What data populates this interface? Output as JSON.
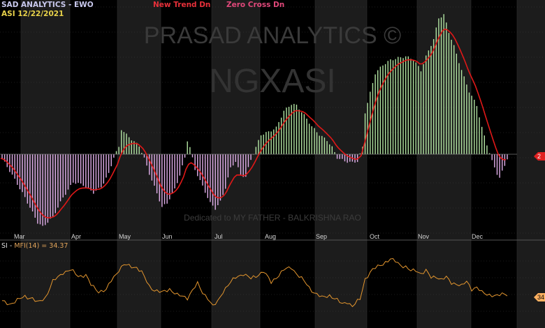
{
  "header": {
    "title": "SAD ANALYTICS - EWO",
    "symbol_date": "ASI   12/22/2021"
  },
  "legend": [
    "New Trend Dn",
    "Zero Cross Dn"
  ],
  "watermark": {
    "line1": "PRASAD ANALYTICS ©",
    "line2": "NGXASI",
    "dedication": "Dedicated to MY FATHER - BALKRISHNA RAO"
  },
  "lower_panel": {
    "label_prefix": "SI - ",
    "label_indicator": "MFI(14) = 34.37"
  },
  "colors": {
    "background": "#000000",
    "band_alt": "#1c1c1c",
    "grid": "#3a3a3a",
    "positive_bar": "#b4e6a4",
    "negative_bar": "#e3b0ec",
    "ewo_line": "#e01818",
    "mfi_line": "#e4962e",
    "tag_red": "#e02020",
    "tag_orange": "#ffb060"
  },
  "chart_data": [
    {
      "type": "bar",
      "name": "EWO histogram with red signal line",
      "months": [
        "Mar",
        "Apr",
        "May",
        "Jun",
        "Jul",
        "Aug",
        "Sep",
        "Oct",
        "Nov",
        "Dec"
      ],
      "bar_count": 200,
      "ewo_anchors": [
        [
          0,
          -6
        ],
        [
          4,
          -30
        ],
        [
          9,
          -62
        ],
        [
          14,
          -98
        ],
        [
          16,
          -104
        ],
        [
          20,
          -90
        ],
        [
          24,
          -62
        ],
        [
          28,
          -40
        ],
        [
          32,
          -44
        ],
        [
          36,
          -55
        ],
        [
          39,
          -47
        ],
        [
          42,
          -28
        ],
        [
          44,
          -4
        ],
        [
          46,
          10
        ],
        [
          47,
          36
        ],
        [
          49,
          28
        ],
        [
          52,
          18
        ],
        [
          54,
          12
        ],
        [
          56,
          -6
        ],
        [
          58,
          -28
        ],
        [
          61,
          -56
        ],
        [
          63,
          -76
        ],
        [
          65,
          -70
        ],
        [
          68,
          -50
        ],
        [
          70,
          -30
        ],
        [
          72,
          -5
        ],
        [
          73,
          20
        ],
        [
          74,
          10
        ],
        [
          76,
          -22
        ],
        [
          79,
          -46
        ],
        [
          82,
          -70
        ],
        [
          84,
          -78
        ],
        [
          86,
          -68
        ],
        [
          88,
          -48
        ],
        [
          90,
          -20
        ],
        [
          92,
          -10
        ],
        [
          94,
          -30
        ],
        [
          96,
          -32
        ],
        [
          98,
          -8
        ],
        [
          100,
          10
        ],
        [
          102,
          28
        ],
        [
          105,
          32
        ],
        [
          108,
          38
        ],
        [
          111,
          62
        ],
        [
          114,
          72
        ],
        [
          116,
          70
        ],
        [
          119,
          56
        ],
        [
          122,
          40
        ],
        [
          125,
          28
        ],
        [
          128,
          20
        ],
        [
          130,
          10
        ],
        [
          132,
          -5
        ],
        [
          135,
          -10
        ],
        [
          138,
          -12
        ],
        [
          140,
          -10
        ],
        [
          142,
          10
        ],
        [
          143,
          60
        ],
        [
          145,
          88
        ],
        [
          147,
          116
        ],
        [
          150,
          128
        ],
        [
          153,
          135
        ],
        [
          156,
          138
        ],
        [
          159,
          140
        ],
        [
          162,
          136
        ],
        [
          165,
          120
        ],
        [
          167,
          140
        ],
        [
          170,
          165
        ],
        [
          172,
          195
        ],
        [
          174,
          200
        ],
        [
          176,
          175
        ],
        [
          178,
          155
        ],
        [
          180,
          132
        ],
        [
          182,
          110
        ],
        [
          184,
          90
        ],
        [
          187,
          70
        ],
        [
          189,
          38
        ],
        [
          191,
          14
        ],
        [
          193,
          -10
        ],
        [
          195,
          -28
        ],
        [
          196,
          -34
        ],
        [
          198,
          -16
        ],
        [
          199,
          -6
        ],
        [
          200,
          0
        ]
      ],
      "signal_line": "smoothed EWO (red)",
      "current_value_tag": "2"
    },
    {
      "type": "line",
      "name": "MFI(14)",
      "last_value": 34.37,
      "current_value_tag": "34",
      "mfi_anchors": [
        [
          0,
          22
        ],
        [
          3,
          18
        ],
        [
          6,
          24
        ],
        [
          9,
          30
        ],
        [
          12,
          27
        ],
        [
          14,
          20
        ],
        [
          17,
          28
        ],
        [
          20,
          54
        ],
        [
          22,
          60
        ],
        [
          24,
          68
        ],
        [
          27,
          72
        ],
        [
          30,
          62
        ],
        [
          33,
          64
        ],
        [
          35,
          48
        ],
        [
          38,
          38
        ],
        [
          41,
          40
        ],
        [
          43,
          55
        ],
        [
          46,
          72
        ],
        [
          48,
          80
        ],
        [
          50,
          78
        ],
        [
          53,
          76
        ],
        [
          55,
          68
        ],
        [
          58,
          46
        ],
        [
          60,
          40
        ],
        [
          63,
          36
        ],
        [
          66,
          42
        ],
        [
          69,
          32
        ],
        [
          71,
          30
        ],
        [
          73,
          28
        ],
        [
          75,
          40
        ],
        [
          77,
          50
        ],
        [
          79,
          36
        ],
        [
          81,
          28
        ],
        [
          83,
          14
        ],
        [
          85,
          22
        ],
        [
          87,
          38
        ],
        [
          89,
          48
        ],
        [
          92,
          60
        ],
        [
          95,
          66
        ],
        [
          98,
          58
        ],
        [
          100,
          62
        ],
        [
          103,
          70
        ],
        [
          106,
          52
        ],
        [
          109,
          64
        ],
        [
          111,
          72
        ],
        [
          114,
          76
        ],
        [
          116,
          66
        ],
        [
          119,
          54
        ],
        [
          121,
          44
        ],
        [
          123,
          36
        ],
        [
          126,
          28
        ],
        [
          129,
          32
        ],
        [
          132,
          24
        ],
        [
          134,
          18
        ],
        [
          136,
          22
        ],
        [
          138,
          14
        ],
        [
          141,
          26
        ],
        [
          143,
          58
        ],
        [
          146,
          72
        ],
        [
          149,
          80
        ],
        [
          151,
          84
        ],
        [
          153,
          88
        ],
        [
          155,
          86
        ],
        [
          157,
          80
        ],
        [
          159,
          76
        ],
        [
          161,
          70
        ],
        [
          163,
          72
        ],
        [
          165,
          66
        ],
        [
          167,
          70
        ],
        [
          169,
          60
        ],
        [
          171,
          62
        ],
        [
          173,
          56
        ],
        [
          175,
          60
        ],
        [
          177,
          52
        ],
        [
          179,
          50
        ],
        [
          181,
          46
        ],
        [
          183,
          54
        ],
        [
          185,
          42
        ],
        [
          187,
          44
        ],
        [
          189,
          36
        ],
        [
          191,
          34
        ],
        [
          193,
          32
        ],
        [
          195,
          30
        ],
        [
          197,
          34
        ],
        [
          199,
          34
        ]
      ]
    }
  ]
}
